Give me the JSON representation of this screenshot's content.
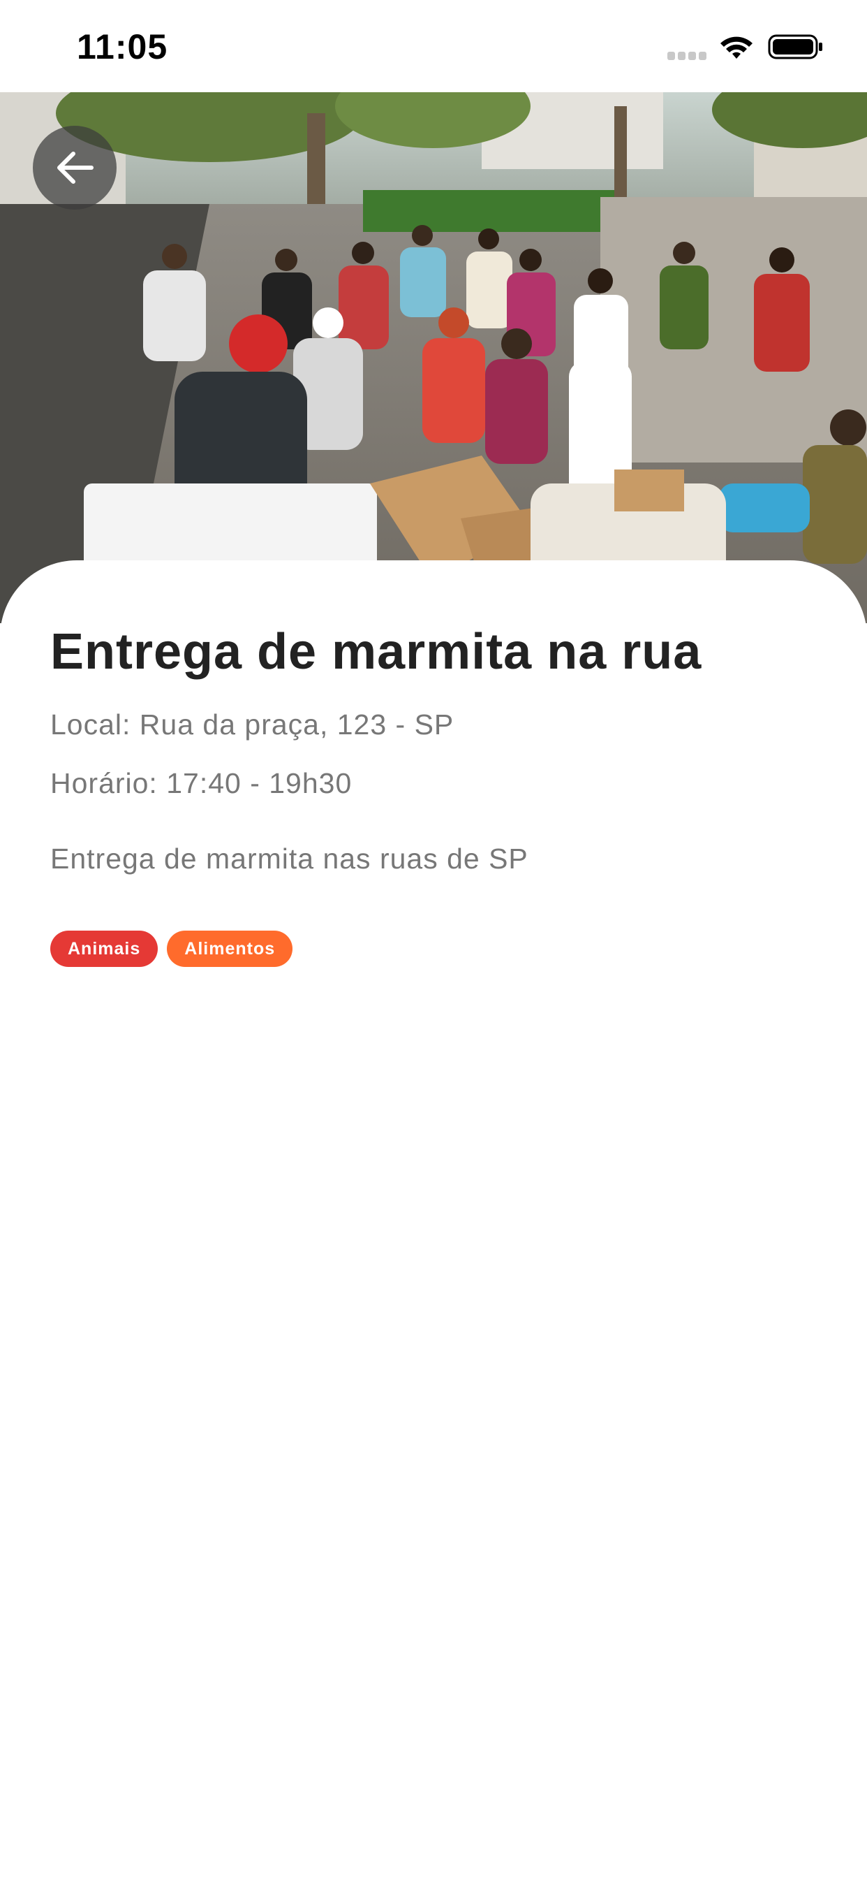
{
  "status_bar": {
    "time": "11:05"
  },
  "hero": {
    "image": "street-food-distribution-photo",
    "back_icon": "arrow-left-icon"
  },
  "event": {
    "title": "Entrega de marmita na rua",
    "location": "Local: Rua da praça, 123 - SP",
    "schedule": "Horário: 17:40 - 19h30",
    "description": "Entrega de marmita nas ruas de SP",
    "tags": [
      {
        "label": "Animais",
        "color": "#e53935"
      },
      {
        "label": "Alimentos",
        "color": "#ff6b2c"
      }
    ]
  }
}
